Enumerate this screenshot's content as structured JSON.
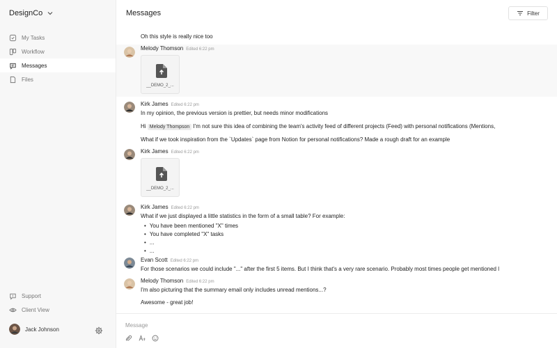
{
  "sidebar": {
    "workspace": "DesignCo",
    "items": [
      {
        "label": "My Tasks",
        "icon": "check-square-icon"
      },
      {
        "label": "Workflow",
        "icon": "board-icon"
      },
      {
        "label": "Messages",
        "icon": "chat-icon",
        "active": true
      },
      {
        "label": "Files",
        "icon": "file-icon"
      }
    ],
    "bottom": [
      {
        "label": "Support",
        "icon": "help-icon"
      },
      {
        "label": "Client View",
        "icon": "eye-icon"
      }
    ],
    "user": {
      "name": "Jack Johnson"
    }
  },
  "header": {
    "title": "Messages",
    "filter_label": "Filter"
  },
  "messages": {
    "m0_text": "Oh this style is really nice too",
    "m1_author": "Melody Thomson",
    "m1_edited": "Edited 6:22 pm",
    "m1_file": "__DEMO_2_...",
    "m2_author": "Kirk James",
    "m2_edited": "Edited 6:22 pm",
    "m2_line1": "In my opinion, the previous version is prettier, but needs minor modifications",
    "m2_line2_pre": "Hi",
    "m2_mention": "Melody Thompson",
    "m2_line2_post": "I'm not sure this idea of combining the team's activity feed of different projects (Feed) with personal notifications (Mentions,",
    "m2_line3": "What if we took inspiration from the `Updates` page from Notion for personal notifications? Made a rough draft for an example",
    "m3_author": "Kirk James",
    "m3_edited": "Edited 6:22 pm",
    "m3_file": "__DEMO_2_...",
    "m4_author": "Kirk James",
    "m4_edited": "Edited 6:22 pm",
    "m4_line1": "What if we just displayed a little statistics in the form of a small table? For example:",
    "m4_bullets": [
      "You have been mentioned \"X\" times",
      "You have completed \"X\" tasks",
      "...",
      "..."
    ],
    "m5_author": "Evan Scott",
    "m5_edited": "Edited 6:22 pm",
    "m5_line1": "For those scenarios we could include \"...\" after the first 5 items. But I think that's a very rare scenario. Probably most times people get mentioned l",
    "m6_author": "Melody Thomson",
    "m6_edited": "Edited 6:22 pm",
    "m6_line1": "I'm also picturing that the summary email only includes unread mentions...?",
    "m6_line2": "Awesome - great job!"
  },
  "composer": {
    "placeholder": "Message",
    "tools": [
      "paperclip-icon",
      "text-format-icon",
      "emoji-icon"
    ]
  },
  "colors": {
    "sidebar_bg": "#f7f7f7",
    "active_item_bg": "#ffffff",
    "highlight_row": "#f8f8f8",
    "muted_text": "#999999"
  }
}
